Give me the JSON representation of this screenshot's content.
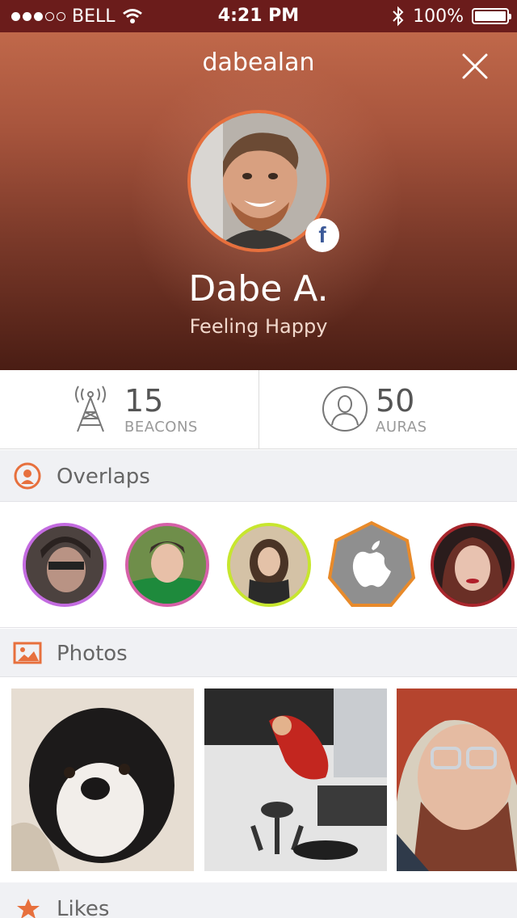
{
  "status_bar": {
    "carrier": "BELL",
    "time": "4:21 PM",
    "battery": "100%",
    "signal_bars_filled": 3,
    "signal_bars_total": 5
  },
  "profile": {
    "username": "dabealan",
    "name": "Dabe A.",
    "status": "Feeling Happy"
  },
  "stats": {
    "beacons": {
      "value": "15",
      "label": "BEACONS"
    },
    "auras": {
      "value": "50",
      "label": "AURAS"
    }
  },
  "sections": {
    "overlaps": "Overlaps",
    "photos": "Photos",
    "likes": "Likes"
  },
  "colors": {
    "accent": "#e7703d",
    "status_bar": "#6b1c1b"
  },
  "overlaps": [
    {
      "ring": "#c36be0"
    },
    {
      "ring": "#d660a8"
    },
    {
      "ring": "#c7e62e"
    },
    {
      "ring": "#e88a2a",
      "icon": "apple-icon"
    },
    {
      "ring": "#a8262c"
    }
  ]
}
